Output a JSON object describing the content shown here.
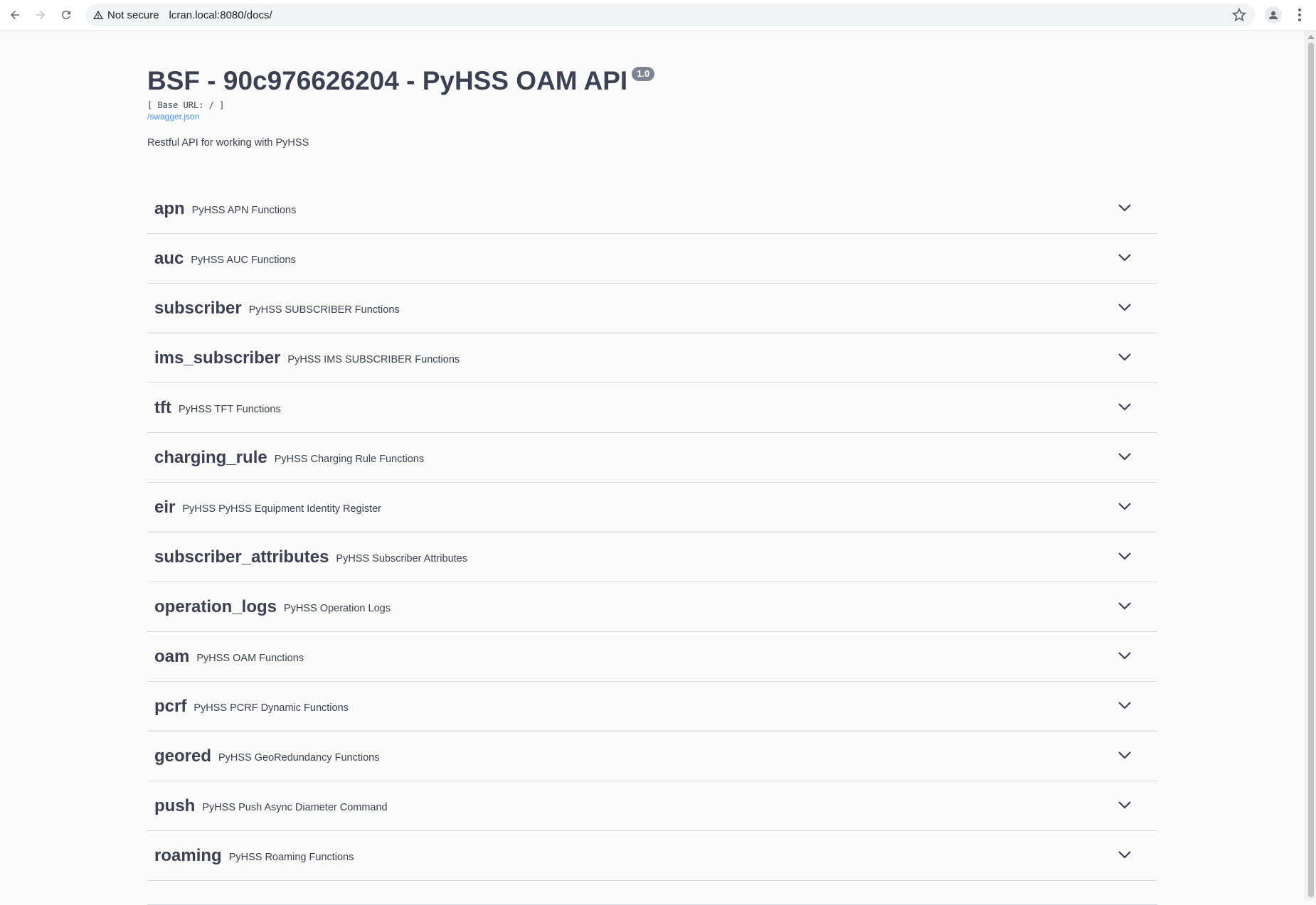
{
  "browser": {
    "security_label": "Not secure",
    "url": "lcran.local:8080/docs/"
  },
  "api": {
    "title": "BSF - 90c976626204 - PyHSS OAM API",
    "version": "1.0",
    "base_url": "[ Base URL: / ]",
    "spec_link": "/swagger.json",
    "description": "Restful API for working with PyHSS"
  },
  "tags": [
    {
      "name": "apn",
      "description": "PyHSS APN Functions"
    },
    {
      "name": "auc",
      "description": "PyHSS AUC Functions"
    },
    {
      "name": "subscriber",
      "description": "PyHSS SUBSCRIBER Functions"
    },
    {
      "name": "ims_subscriber",
      "description": "PyHSS IMS SUBSCRIBER Functions"
    },
    {
      "name": "tft",
      "description": "PyHSS TFT Functions"
    },
    {
      "name": "charging_rule",
      "description": "PyHSS Charging Rule Functions"
    },
    {
      "name": "eir",
      "description": "PyHSS PyHSS Equipment Identity Register"
    },
    {
      "name": "subscriber_attributes",
      "description": "PyHSS Subscriber Attributes"
    },
    {
      "name": "operation_logs",
      "description": "PyHSS Operation Logs"
    },
    {
      "name": "oam",
      "description": "PyHSS OAM Functions"
    },
    {
      "name": "pcrf",
      "description": "PyHSS PCRF Dynamic Functions"
    },
    {
      "name": "geored",
      "description": "PyHSS GeoRedundancy Functions"
    },
    {
      "name": "push",
      "description": "PyHSS Push Async Diameter Command"
    },
    {
      "name": "roaming",
      "description": "PyHSS Roaming Functions"
    }
  ],
  "icons": {
    "back": "arrow-left-icon",
    "forward": "arrow-right-icon",
    "reload": "reload-icon",
    "warning": "warning-triangle-icon",
    "bookmark": "star-icon",
    "profile": "person-icon",
    "menu": "kebab-menu-icon",
    "expand": "chevron-down-icon"
  }
}
